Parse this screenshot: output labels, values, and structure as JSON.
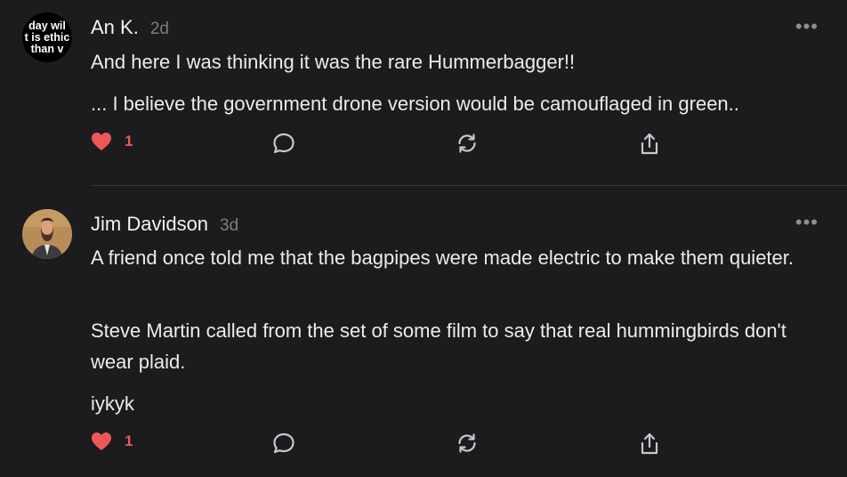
{
  "comments": [
    {
      "author": "An K.",
      "age": "2d",
      "avatar_lines": [
        "day wil",
        "t is ethic",
        "than v"
      ],
      "paragraphs": [
        "And here I was thinking it was the rare Hummerbagger!!",
        "... I believe the government drone version would be camouflaged in green.."
      ],
      "likes": "1",
      "icons": [
        "heart-icon",
        "comment-icon",
        "restack-icon",
        "share-icon",
        "more-icon"
      ]
    },
    {
      "author": "Jim Davidson",
      "age": "3d",
      "paragraphs": [
        "A friend once told me that the bagpipes were made electric to make them quieter.",
        "Steve Martin called from the set of some film to say that real hummingbirds don't wear plaid.",
        "iykyk"
      ],
      "likes": "1",
      "icons": [
        "heart-icon",
        "comment-icon",
        "restack-icon",
        "share-icon",
        "more-icon"
      ]
    }
  ],
  "colors": {
    "background": "#1c1c1e",
    "like": "#ef5757",
    "text": "#ececec",
    "muted": "#7d7d82"
  },
  "more_glyph": "•••"
}
